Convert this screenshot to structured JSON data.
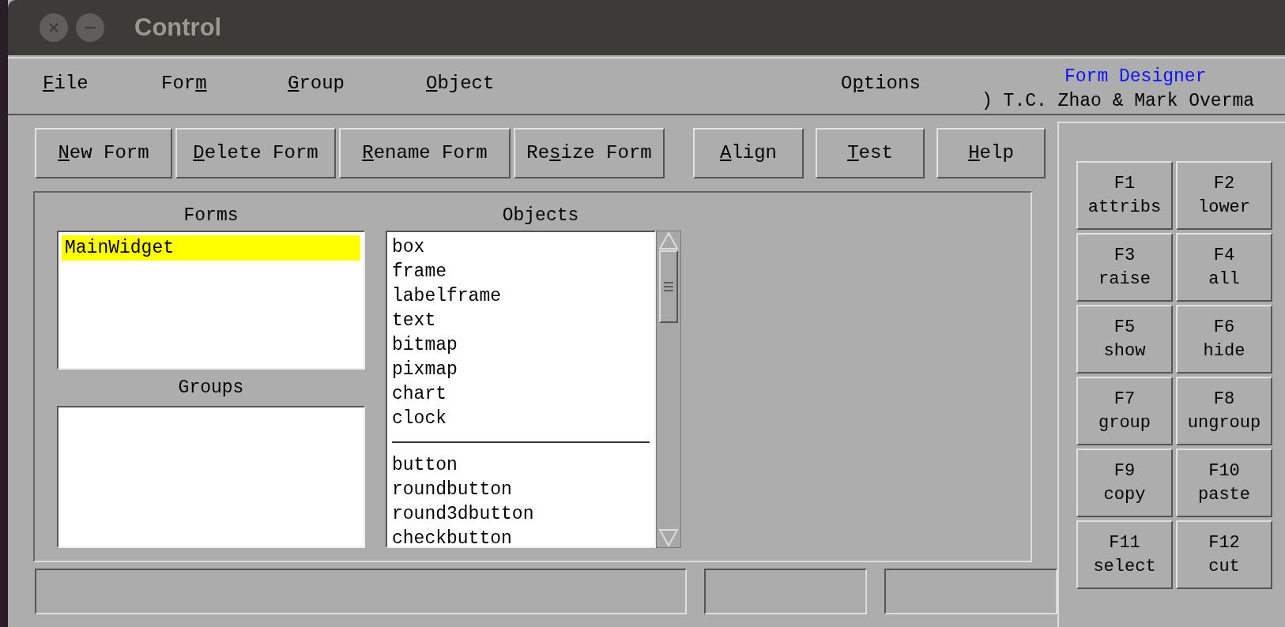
{
  "window": {
    "title": "Control"
  },
  "menu": [
    {
      "label": [
        {
          "text": "F",
          "underline": true
        },
        {
          "text": "ile",
          "underline": false
        }
      ]
    },
    {
      "label": [
        {
          "text": "For",
          "underline": false
        },
        {
          "text": "m",
          "underline": true
        }
      ]
    },
    {
      "label": [
        {
          "text": "G",
          "underline": true
        },
        {
          "text": "roup",
          "underline": false
        }
      ]
    },
    {
      "label": [
        {
          "text": "O",
          "underline": true
        },
        {
          "text": "bject",
          "underline": false
        }
      ]
    },
    {
      "label": [
        {
          "text": "O",
          "underline": false
        },
        {
          "text": "p",
          "underline": true
        },
        {
          "text": "tions",
          "underline": false
        }
      ]
    }
  ],
  "app_title": "Form Designer",
  "credit": ") T.C. Zhao & Mark Overma",
  "form_buttons": [
    {
      "label": [
        {
          "text": "N",
          "underline": true
        },
        {
          "text": "ew Form",
          "underline": false
        }
      ]
    },
    {
      "label": [
        {
          "text": "D",
          "underline": true
        },
        {
          "text": "elete Form",
          "underline": false
        }
      ]
    },
    {
      "label": [
        {
          "text": "R",
          "underline": true
        },
        {
          "text": "ename Form",
          "underline": false
        }
      ]
    },
    {
      "label": [
        {
          "text": "Re",
          "underline": false
        },
        {
          "text": "s",
          "underline": true
        },
        {
          "text": "ize Form",
          "underline": false
        }
      ]
    }
  ],
  "tool_buttons": [
    {
      "label": [
        {
          "text": "A",
          "underline": true
        },
        {
          "text": "lign",
          "underline": false
        }
      ]
    },
    {
      "label": [
        {
          "text": "T",
          "underline": true
        },
        {
          "text": "est",
          "underline": false
        }
      ]
    },
    {
      "label": [
        {
          "text": "H",
          "underline": true
        },
        {
          "text": "elp",
          "underline": false
        }
      ]
    }
  ],
  "forms": {
    "label": "Forms",
    "items": [
      {
        "name": "MainWidget",
        "selected": true
      }
    ]
  },
  "groups": {
    "label": "Groups"
  },
  "objects": {
    "label": "Objects",
    "items": [
      {
        "kind": "item",
        "name": "box"
      },
      {
        "kind": "item",
        "name": "frame"
      },
      {
        "kind": "item",
        "name": "labelframe"
      },
      {
        "kind": "item",
        "name": "text"
      },
      {
        "kind": "item",
        "name": "bitmap"
      },
      {
        "kind": "item",
        "name": "pixmap"
      },
      {
        "kind": "item",
        "name": "chart"
      },
      {
        "kind": "item",
        "name": "clock"
      },
      {
        "kind": "separator"
      },
      {
        "kind": "item",
        "name": "button"
      },
      {
        "kind": "item",
        "name": "roundbutton"
      },
      {
        "kind": "item",
        "name": "round3dbutton"
      },
      {
        "kind": "item",
        "name": "checkbutton"
      }
    ]
  },
  "function_keys": [
    {
      "key": "F1",
      "action": "attribs"
    },
    {
      "key": "F2",
      "action": "lower"
    },
    {
      "key": "F3",
      "action": "raise"
    },
    {
      "key": "F4",
      "action": "all"
    },
    {
      "key": "F5",
      "action": "show"
    },
    {
      "key": "F6",
      "action": "hide"
    },
    {
      "key": "F7",
      "action": "group"
    },
    {
      "key": "F8",
      "action": "ungroup"
    },
    {
      "key": "F9",
      "action": "copy"
    },
    {
      "key": "F10",
      "action": "paste"
    },
    {
      "key": "F11",
      "action": "select"
    },
    {
      "key": "F12",
      "action": "cut"
    }
  ]
}
